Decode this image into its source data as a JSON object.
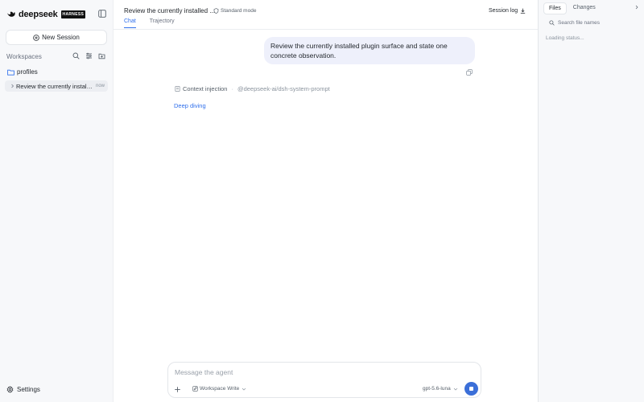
{
  "sidebar": {
    "brand_name": "deepseek",
    "brand_tag": "HARNESS",
    "new_session_label": "New Session",
    "workspaces_label": "Workspaces",
    "folder_name": "profiles",
    "sessions": [
      {
        "title": "Review the currently installed plugin surface",
        "time": "now"
      }
    ],
    "settings_label": "Settings"
  },
  "header": {
    "session_title": "Review the currently installed ...",
    "mode_label": "Standard mode",
    "session_log_label": "Session log",
    "tabs": [
      {
        "label": "Chat",
        "active": true
      },
      {
        "label": "Trajectory",
        "active": false
      }
    ]
  },
  "chat": {
    "user_message": "Review the currently installed plugin surface and state one concrete observation.",
    "context_label": "Context injection",
    "context_value": "@deepseek-ai/dsh-system-prompt",
    "status_text": "Deep diving"
  },
  "composer": {
    "placeholder": "Message the agent",
    "permission_label": "Workspace Write",
    "model_label": "gpt-5.6-luna"
  },
  "right_panel": {
    "tabs": [
      {
        "label": "Files",
        "active": true
      },
      {
        "label": "Changes",
        "active": false
      }
    ],
    "search_placeholder": "Search file names",
    "status_text": "Loading status..."
  },
  "colors": {
    "accent": "#2f6feb",
    "send_button": "#3b6fd8",
    "user_bubble": "#eef0fb",
    "sidebar_bg": "#f7f8fa"
  },
  "icons": [
    "deepseek-whale-icon",
    "sidebar-toggle-icon",
    "plus-circle-icon",
    "search-icon",
    "filter-icon",
    "new-folder-icon",
    "folder-icon",
    "chevron-right-icon",
    "gear-icon",
    "shield-icon",
    "download-icon",
    "copy-icon",
    "document-icon",
    "plus-icon",
    "pencil-icon",
    "chevron-down-icon",
    "stop-icon"
  ]
}
